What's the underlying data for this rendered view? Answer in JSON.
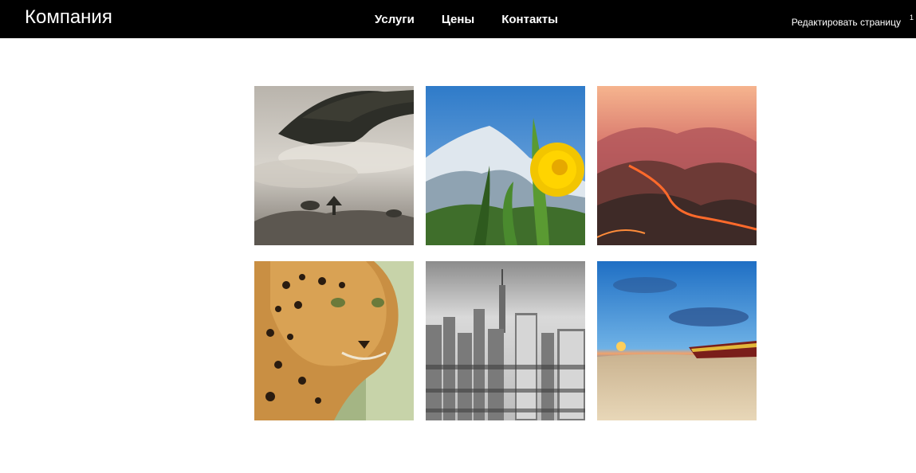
{
  "header": {
    "brand": "Компания",
    "nav": [
      {
        "label": "Услуги"
      },
      {
        "label": "Цены"
      },
      {
        "label": "Контакты"
      }
    ],
    "edit_label": "Редактировать страницу",
    "edit_marker": "1"
  },
  "gallery": {
    "images": [
      {
        "icon": "misty-hills-image"
      },
      {
        "icon": "dandelion-mountain-image"
      },
      {
        "icon": "lava-valley-image"
      },
      {
        "icon": "leopard-image"
      },
      {
        "icon": "city-skyline-image"
      },
      {
        "icon": "beach-sunset-image"
      }
    ]
  },
  "colors": {
    "header_bg": "#000000",
    "header_text": "#ffffff",
    "page_bg": "#ffffff"
  }
}
